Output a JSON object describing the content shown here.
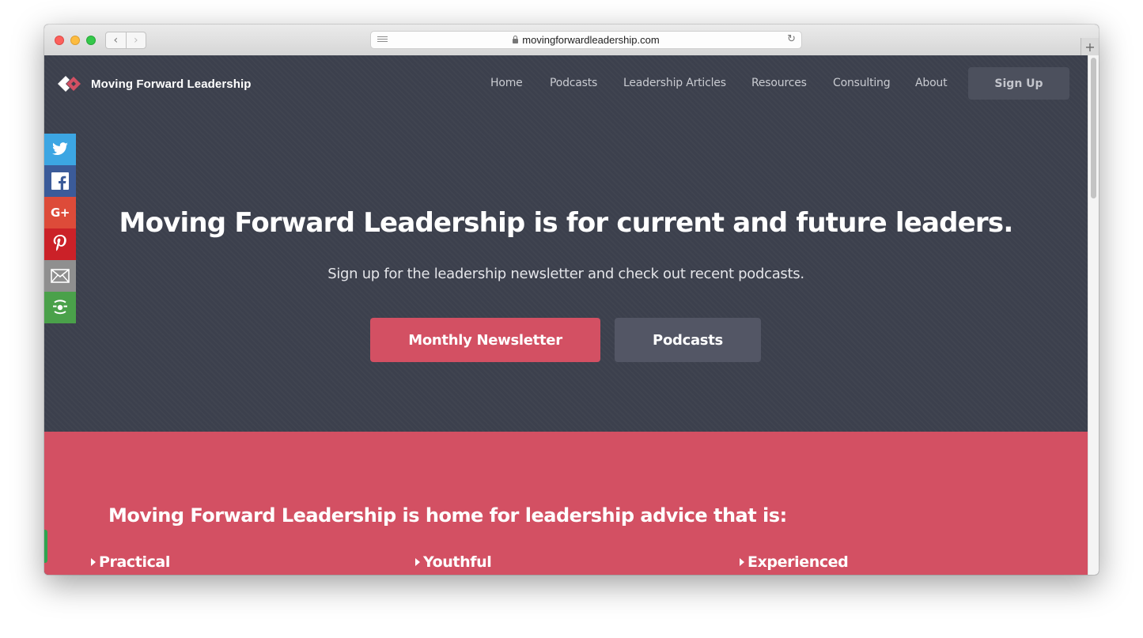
{
  "browser": {
    "url": "movingforwardleadership.com",
    "back_label": "‹",
    "forward_label": "›",
    "reload_label": "↻",
    "new_tab_label": "+"
  },
  "site": {
    "brand_name": "Moving Forward Leadership",
    "nav": [
      "Home",
      "Podcasts",
      "Leadership Articles",
      "Resources",
      "Consulting",
      "About"
    ],
    "signup_label": "Sign Up"
  },
  "share": {
    "icons": [
      "twitter-icon",
      "facebook-icon",
      "google-plus-icon",
      "pinterest-icon",
      "email-icon",
      "more-share-icon"
    ],
    "google_plus_label": "G+"
  },
  "hero": {
    "title": "Moving Forward Leadership is for current and future leaders.",
    "subtitle": "Sign up for the leadership newsletter and check out recent podcasts.",
    "primary_button": "Monthly Newsletter",
    "secondary_button": "Podcasts"
  },
  "band": {
    "title": "Moving Forward Leadership is home for leadership advice that is:",
    "items": [
      "Practical",
      "Youthful",
      "Experienced"
    ]
  },
  "colors": {
    "hero_bg": "#3c404d",
    "accent": "#d35063",
    "secondary_button": "#535665"
  }
}
